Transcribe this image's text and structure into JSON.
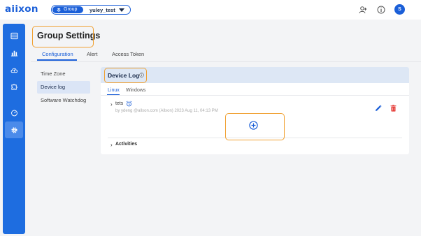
{
  "brand": {
    "logo_text": "aiixon",
    "accent": "#1b5fd8",
    "rail": "#1e6de0",
    "highlight": "#f0a030"
  },
  "header": {
    "group_label": "Group",
    "group_name": "yuley_test",
    "avatar_initial": "S",
    "icons": [
      "add-user-icon",
      "info-icon"
    ]
  },
  "rail": {
    "items": [
      "dashboard-icon",
      "chart-icon",
      "cloud-upload-icon",
      "puzzle-icon",
      "speed-icon",
      "gear-icon"
    ],
    "active": "gear-icon"
  },
  "page": {
    "title": "Group Settings",
    "tabs": [
      {
        "label": "Configuration",
        "active": true
      },
      {
        "label": "Alert",
        "active": false
      },
      {
        "label": "Access Token",
        "active": false
      }
    ]
  },
  "menu": {
    "items": [
      {
        "label": "Time Zone",
        "active": false
      },
      {
        "label": "Device log",
        "active": true
      },
      {
        "label": "Software Watchdog",
        "active": false
      }
    ]
  },
  "device_log": {
    "title": "Device Log",
    "os_tabs": [
      {
        "label": "Linux",
        "active": true
      },
      {
        "label": "Windows",
        "active": false
      }
    ],
    "entries": [
      {
        "name": "tets",
        "meta": "by ydeng @allxon.com (Allxon) 2023 Aug 11, 04:13 PM"
      }
    ],
    "activities_label": "Activities"
  }
}
